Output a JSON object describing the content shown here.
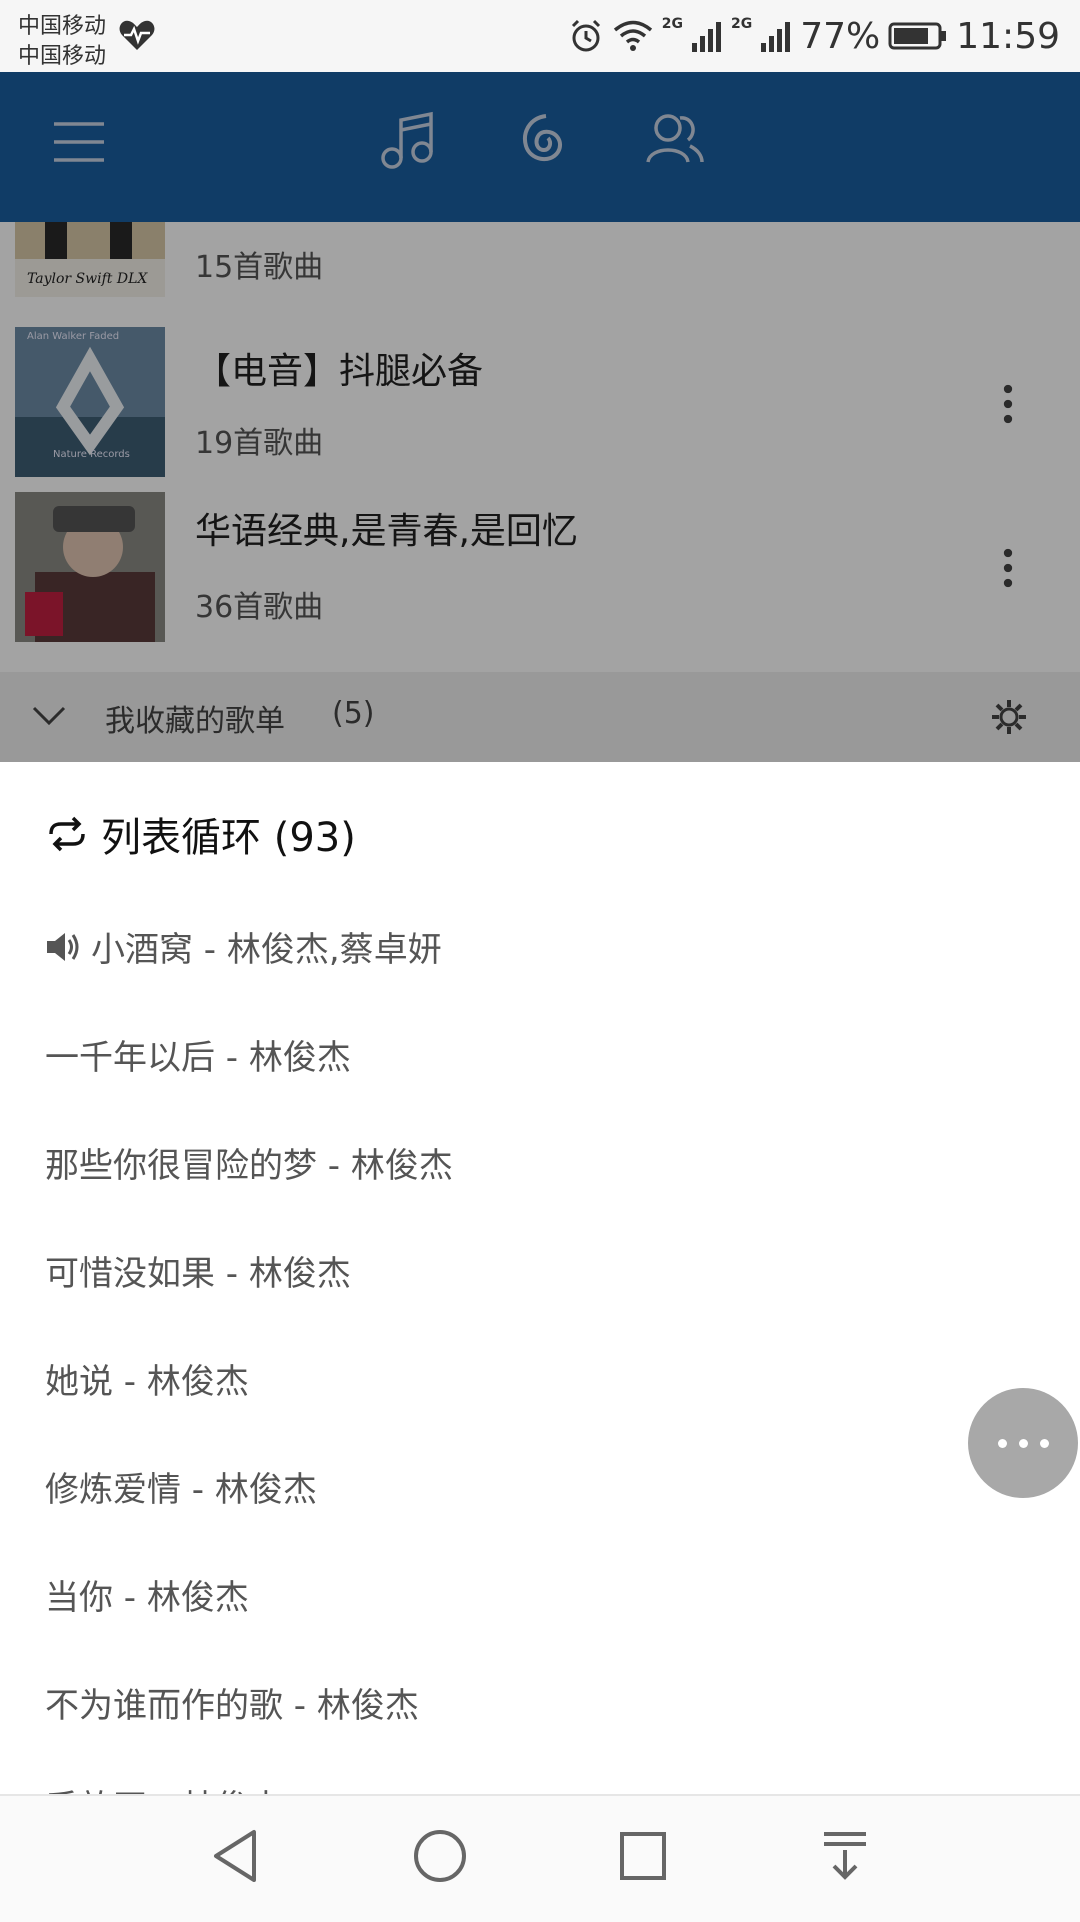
{
  "status_bar": {
    "carrier_1": "中国移动",
    "carrier_2": "中国移动",
    "network_1": "2G",
    "network_2": "2G",
    "battery_percent": "77%",
    "time": "11:59"
  },
  "header": {
    "icons": [
      "menu-icon",
      "music-note-icon",
      "netease-logo-icon",
      "friends-icon"
    ],
    "brand_color": "#1a5fa0"
  },
  "playlists": [
    {
      "cover_text": "Taylor Swift  DLX",
      "count": "15首歌曲"
    },
    {
      "title": "【电音】抖腿必备",
      "count": "19首歌曲",
      "cover_text_top": "Alan Walker Faded",
      "cover_text_bottom": "Nature Records"
    },
    {
      "title": "华语经典,是青春,是回忆",
      "count": "36首歌曲"
    }
  ],
  "collected_section": {
    "label": "我收藏的歌单",
    "count": "(5)"
  },
  "queue": {
    "mode_label": "列表循环 (93)",
    "songs": [
      "小酒窝 - 林俊杰,蔡卓妍",
      "一千年以后 - 林俊杰",
      "那些你很冒险的梦 - 林俊杰",
      "可惜没如果 - 林俊杰",
      "她说 - 林俊杰",
      "修炼爱情 - 林俊杰",
      "当你 - 林俊杰",
      "不为谁而作的歌 - 林俊杰",
      "手放开 - 林俊杰"
    ]
  }
}
